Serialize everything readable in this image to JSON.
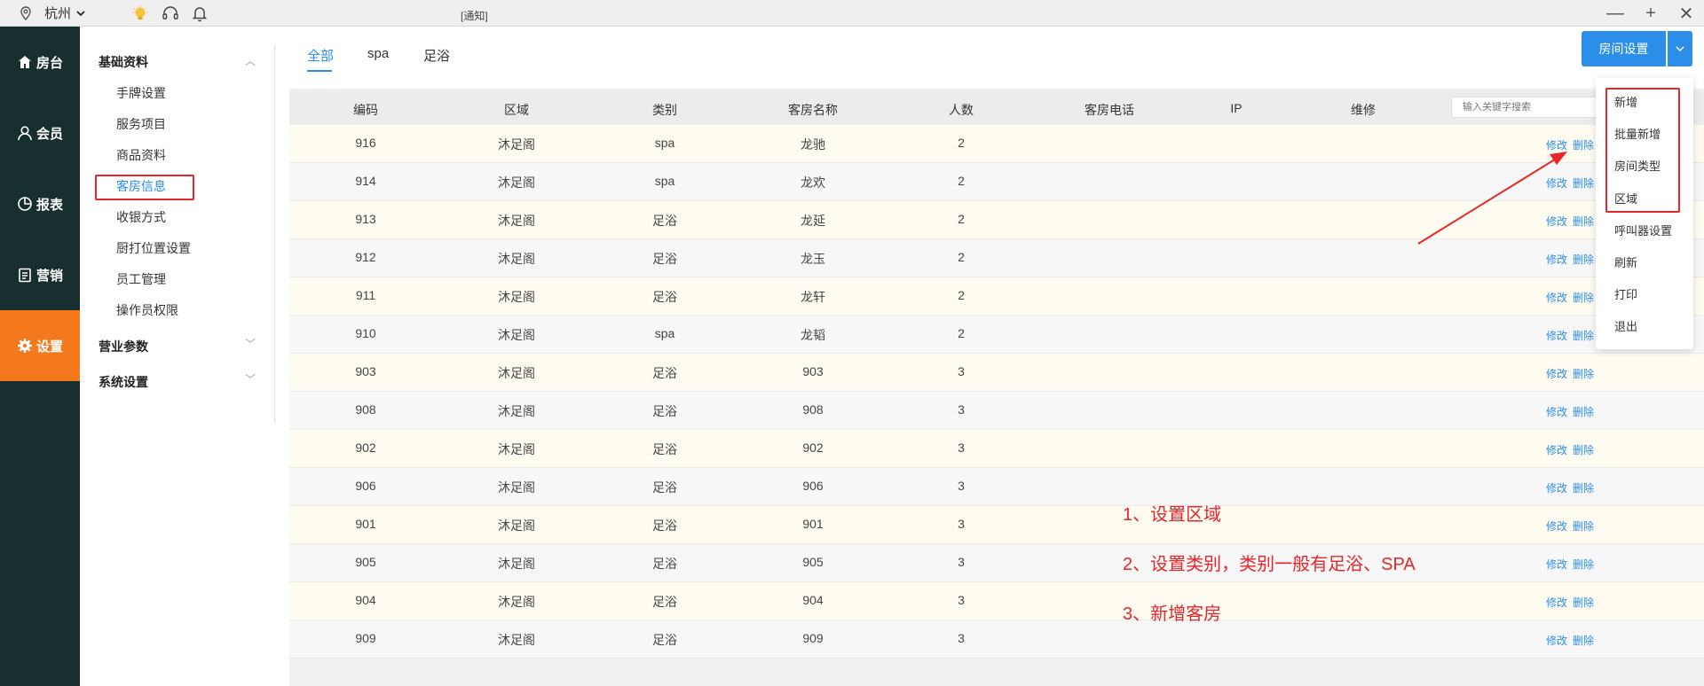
{
  "topbar": {
    "city": "杭州",
    "window_title": "[通知]",
    "icons": [
      "location-pin-icon",
      "lightbulb-icon",
      "headset-icon",
      "bell-icon"
    ],
    "controls": [
      "—",
      "+",
      "✕"
    ]
  },
  "leftnav": {
    "items": [
      {
        "label": "房台",
        "icon": "home-icon"
      },
      {
        "label": "会员",
        "icon": "user-icon"
      },
      {
        "label": "报表",
        "icon": "pie-chart-icon"
      },
      {
        "label": "营销",
        "icon": "clipboard-icon"
      },
      {
        "label": "设置",
        "icon": "gear-icon"
      }
    ],
    "active_index": 4,
    "active_color": "#f4781c"
  },
  "submenu": {
    "group1": "基础资料",
    "items": [
      "手牌设置",
      "服务项目",
      "商品资料",
      "客房信息",
      "收银方式",
      "厨打位置设置",
      "员工管理",
      "操作员权限"
    ],
    "active_item": "客房信息",
    "group2": "营业参数",
    "group3": "系统设置"
  },
  "tabs": [
    {
      "label": "全部"
    },
    {
      "label": "spa"
    },
    {
      "label": "足浴"
    }
  ],
  "room_button": {
    "label": "房间设置"
  },
  "table": {
    "headers": [
      "编码",
      "区域",
      "类别",
      "客房名称",
      "人数",
      "客房电话",
      "IP",
      "维修"
    ],
    "search_placeholder": "输入关键字搜索",
    "edit_label": "修改",
    "delete_label": "删除",
    "rows": [
      {
        "code": "916",
        "area": "沐足阁",
        "type": "spa",
        "name": "龙驰",
        "people": "2"
      },
      {
        "code": "914",
        "area": "沐足阁",
        "type": "spa",
        "name": "龙欢",
        "people": "2"
      },
      {
        "code": "913",
        "area": "沐足阁",
        "type": "足浴",
        "name": "龙延",
        "people": "2"
      },
      {
        "code": "912",
        "area": "沐足阁",
        "type": "足浴",
        "name": "龙玉",
        "people": "2"
      },
      {
        "code": "911",
        "area": "沐足阁",
        "type": "足浴",
        "name": "龙轩",
        "people": "2"
      },
      {
        "code": "910",
        "area": "沐足阁",
        "type": "spa",
        "name": "龙韬",
        "people": "2"
      },
      {
        "code": "903",
        "area": "沐足阁",
        "type": "足浴",
        "name": "903",
        "people": "3"
      },
      {
        "code": "908",
        "area": "沐足阁",
        "type": "足浴",
        "name": "908",
        "people": "3"
      },
      {
        "code": "902",
        "area": "沐足阁",
        "type": "足浴",
        "name": "902",
        "people": "3"
      },
      {
        "code": "906",
        "area": "沐足阁",
        "type": "足浴",
        "name": "906",
        "people": "3"
      },
      {
        "code": "901",
        "area": "沐足阁",
        "type": "足浴",
        "name": "901",
        "people": "3"
      },
      {
        "code": "905",
        "area": "沐足阁",
        "type": "足浴",
        "name": "905",
        "people": "3"
      },
      {
        "code": "904",
        "area": "沐足阁",
        "type": "足浴",
        "name": "904",
        "people": "3"
      },
      {
        "code": "909",
        "area": "沐足阁",
        "type": "足浴",
        "name": "909",
        "people": "3"
      }
    ]
  },
  "dropdown": {
    "items": [
      "新增",
      "批量新增",
      "房间类型",
      "区域",
      "呼叫器设置",
      "刷新",
      "打印",
      "退出"
    ]
  },
  "annotations": {
    "notes": [
      "1、设置区域",
      "2、设置类别，类别一般有足浴、SPA",
      "3、新增客房"
    ],
    "color": "#e8262a"
  }
}
